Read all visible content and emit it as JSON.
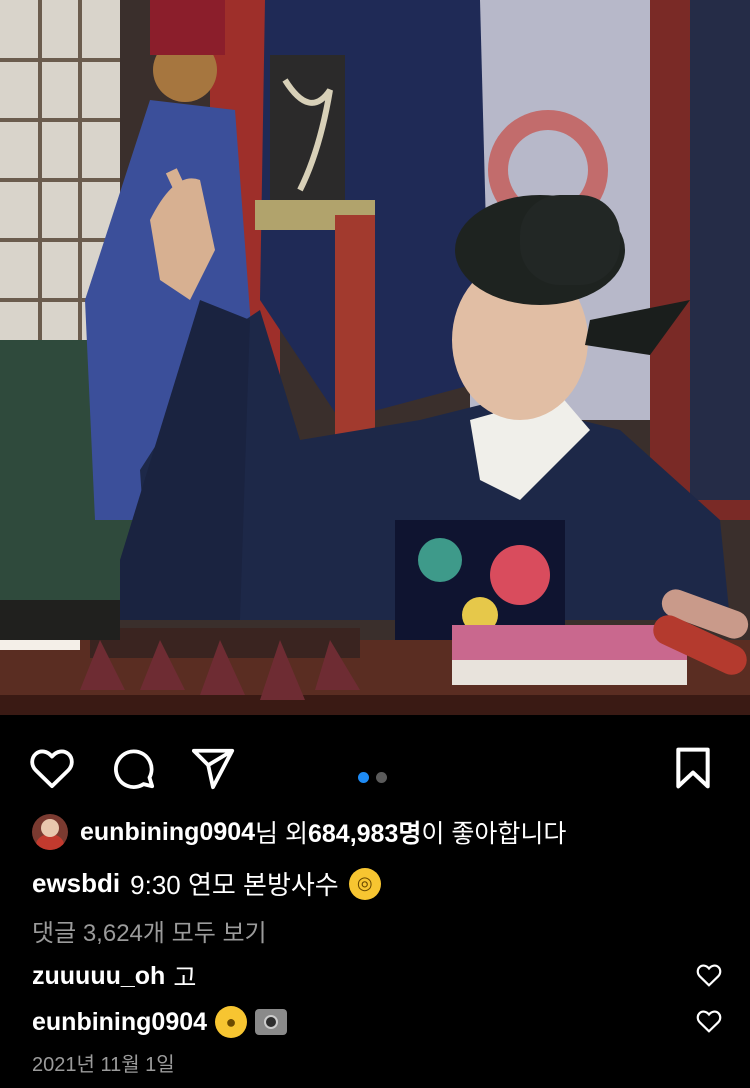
{
  "post": {
    "image_alt": "Actor in dark blue hanbok and gat hat gesturing at a wooden desk on set",
    "carousel": {
      "count": 2,
      "active_index": 0
    }
  },
  "icons": {
    "like": "heart-outline-icon",
    "comment": "speech-bubble-icon",
    "share": "paper-plane-icon",
    "save": "bookmark-icon"
  },
  "likes": {
    "user": "eunbining0904",
    "suffix_pre": "님 외 ",
    "count": "684,983명",
    "suffix_post": "이 좋아합니다"
  },
  "caption": {
    "user": "ewsbdi",
    "text": "9:30 연모 본방사수",
    "emoji": "monocle-face-emoji"
  },
  "view_all_comments": "댓글 3,624개 모두 보기",
  "comments": [
    {
      "user": "zuuuuu_oh",
      "text": "고"
    },
    {
      "user": "eunbining0904",
      "text": "",
      "emojis": [
        "shushing-face-emoji",
        "camera-flash-emoji"
      ]
    }
  ],
  "date": "2021년 11월 1일",
  "colors": {
    "accent": "#1e8bf5",
    "background": "#000000",
    "muted": "#9b9b9b"
  }
}
